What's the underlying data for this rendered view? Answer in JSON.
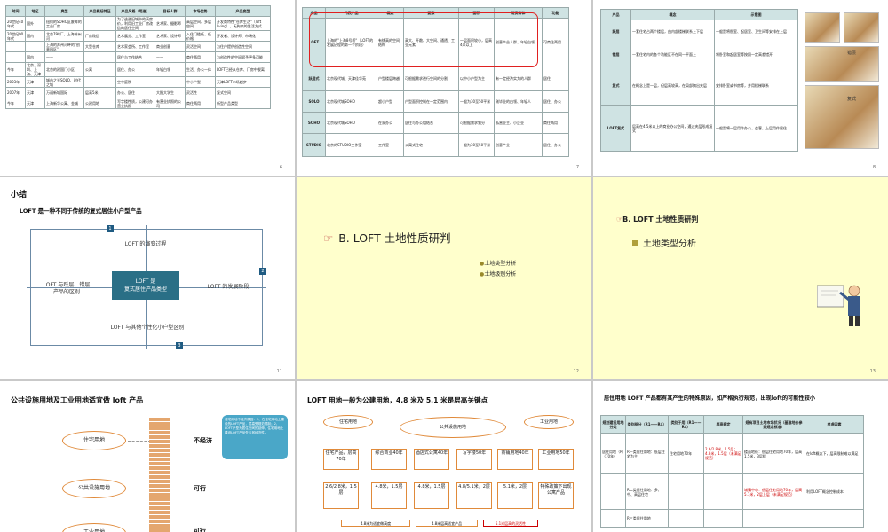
{
  "slide1": {
    "title": "国内外，以住宅为主，其其他地区的相关产品的产品比较",
    "headers": [
      "时间",
      "地区",
      "典型",
      "产品概括特征",
      "产品风格（用途）",
      "目标人群",
      "市场优势",
      "产品变型"
    ],
    "rows": [
      [
        "20世纪40年代",
        "国外",
        "纽约的SOHO区废弃的工业厂房",
        "",
        "为了逃避旧城市的高房价，利用旧工业厂房改造的居住空间",
        "艺术家、摄影师",
        "高层空间、多层空间",
        "开发商特性\"仓库生活\"（loft living），无拘束的生活方式"
      ],
      [
        "20世纪90年代",
        "国内",
        "北京798厂，上海苏州河",
        "厂房改造",
        "艺术展览、工作室",
        "艺术家、设计师",
        "入住门槛低、低价格",
        "开发者、设计师、市场化"
      ],
      [
        "",
        "",
        "上海的苏州河畔的\"创意园区\"",
        "大型仓库",
        "艺术家会所、工作室",
        "商业创意",
        "灵活空间",
        "为住户提供创造性空间"
      ],
      [
        "",
        "国内",
        "——",
        "",
        "居住与工作结合",
        "——",
        "商住两用",
        "为创造性的空间赋予更多可能"
      ],
      [
        "今年",
        "北京、深圳、上海、天津",
        "北京的建国门小区",
        "公寓",
        "居住、办公",
        "年轻白领",
        "生活、办公一体",
        "LOFT已经从仓库、厂房中脱离"
      ],
      [
        "2003年",
        "天津",
        "城市之光SOLO、时代之城",
        "",
        "空中庭院",
        "",
        "中小户型",
        "天津LOFT市场起步"
      ],
      [
        "2007年",
        "天津",
        "万通新城国际",
        "层高5米",
        "办公、居住",
        "大批大学生",
        "灵活性",
        "复式空间"
      ],
      [
        "今年",
        "天津",
        "上海新华公寓、金城",
        "公建用地",
        "写字楼性质，公建可办营业执照",
        "有营业执照的公司",
        "商住两用",
        "新型产品类型"
      ]
    ],
    "page": "6"
  },
  "slide2": {
    "title": "业内外的多个项目的比较分析、对比分析",
    "headers": [
      "产品",
      "代表产品",
      "概念",
      "要素",
      "面积",
      "消费群体",
      "功能"
    ],
    "rows": [
      [
        "LOFT",
        "上海的\"上海8号桥\"（LOFT的发展历程的第一个阶段）",
        "有挑高的空间结构",
        "高大、开敞、大空间、通透、工业元素",
        "一层面积较小，层高4米以上",
        "创意产业人群、年轻白领",
        "可商住两用"
      ],
      [
        "跃层式",
        "北京现代城、天津佳华苑",
        "户型楼层跨越",
        "可根据需求进行空间的分割",
        "以中小户型为主",
        "有一定经济实力的人群",
        "居住"
      ],
      [
        "SOLO",
        "北京现代城SOHO",
        "超小户型",
        "户型面积控制在一定范围内",
        "一般为30至50平米",
        "刚毕业的白领、年轻人",
        "居住、办公"
      ],
      [
        "SOHO",
        "北京现代城SOHO",
        "在家办公",
        "居住与办公相结合",
        "可根据需求划分",
        "私营业主、小企业",
        "商住两用"
      ],
      [
        "STUDIO",
        "北京的STUDIO工作室",
        "工作室",
        "公寓式住宅",
        "一般为30至50平米",
        "创意产业",
        "居住、办公"
      ]
    ],
    "page": "7"
  },
  "slide3": {
    "title": "LOFT是一种将多种空间融合的复式住宅",
    "headers": [
      "产品",
      "概念",
      "示意图"
    ],
    "rows": [
      [
        "跃层",
        "一套住宅占两个楼层，由内部楼梯联系上下层",
        "一般是将卧室、起居室、卫生间等安排在上层"
      ],
      [
        "错层",
        "一套住宅内的各个功能区不在同一平面上",
        "将卧室和起居室等按照一定高差错开"
      ],
      [
        "复式",
        "在概念上是一层，但层高较高，在局部掏出夹层",
        "安排卧室或书房等，并用楼梯联系"
      ],
      [
        "LOFT复式",
        "层高在4.5米以上的商业办公空间，通过夹层形成复式",
        "一般是将一层用作办公、会客，上层用作居住"
      ]
    ],
    "pic_labels": [
      "错层",
      "复式"
    ],
    "page": "8"
  },
  "slide4": {
    "title": "小结",
    "subtitle": "LOFT 是一种不同于传统的复式居住小户型产品",
    "center": "LOFT 是\n复式居住产品类型",
    "labels": {
      "top": "LOFT 的演变过程",
      "left": "LOFT 与跃层、错层\n产品的区别",
      "right": "LOFT 的发展阶段",
      "bottom": "LOFT 与其他个性化小户型区别"
    },
    "numbers": [
      "1",
      "2",
      "3"
    ],
    "page": "11"
  },
  "slide5": {
    "title": "B. LOFT 土地性质研判",
    "bullets": [
      "土地类型分析",
      "土地级别分析"
    ],
    "page": "12"
  },
  "slide6": {
    "heading": "B. LOFT 土地性质研判",
    "bullet": "土地类型分析",
    "page": "13"
  },
  "slide7": {
    "title": "公共设施用地及工业用地适宜做 loft 产品",
    "ovals": [
      "住宅用地",
      "公共设施用地",
      "工业用地"
    ],
    "verdicts": [
      "不经济",
      "可行",
      "可行"
    ],
    "callout": "住宅用地不经济原因：1、在住宅用地上建设的LOFT产品，层高受规范限制；2、LOFT户型为居住空间的延伸，住宅用地上建设LOFT产品失去其经济性。",
    "page": "14"
  },
  "slide8": {
    "title": "LOFT 用地一般为公建用地，4.8 米及 5.1 米是层高关键点",
    "top_ovals": [
      "住宅用地",
      "公共设施用地",
      "工业用地"
    ],
    "mid_boxes": [
      "住宅产品，层高70年",
      "综合商业40年",
      "酒店式公寓40年",
      "写字楼50年",
      "商铺用地40年",
      "工业用地50年"
    ],
    "low_boxes": [
      "2.6/2.8米，1.5层",
      "4.8米，1.5层",
      "4.8米，1.5层",
      "4.8/5.1米，2层",
      "5.1米，2层",
      "特殊政策下出现公寓产品"
    ],
    "bars": [
      "4.8米为适宜做高度",
      "4.8米层高适宜产品",
      "5.1米层高的灵活性"
    ],
    "page": "15"
  },
  "slide9": {
    "title": "居住用地 LOFT 产品都有其产生的特殊原因，如严格执行规范，出现loft的可能性较小",
    "headers": [
      "规划建设用地分类",
      "类别细分（R1——R4）",
      "类别于用（R1——R4）",
      "层高规定",
      "规有项目土地市场状况（基准地价参照规定标准）",
      "考虑因素"
    ],
    "rows": [
      [
        "居住用地（R）（70年）",
        "R一类居住用地：低层住宅为主",
        "住宅用地70年",
        "2.6/2.8米，1.5层；4.8米，1.5层（未满足规范）",
        "楼面地价：低层住宅用地70年，层高1.5米，3层楼",
        "在loft概念下，层高限制难以满足"
      ],
      [
        "",
        "R二类居住用地：多、中、高层住宅",
        "",
        "",
        "城镇中心：低层住宅用地70年，层高5.1米，2层上层（未满足规范）",
        "利用LOFT概念控制成本"
      ],
      [
        "",
        "R三类居住用地",
        "",
        "",
        "",
        ""
      ]
    ],
    "page": "16"
  }
}
